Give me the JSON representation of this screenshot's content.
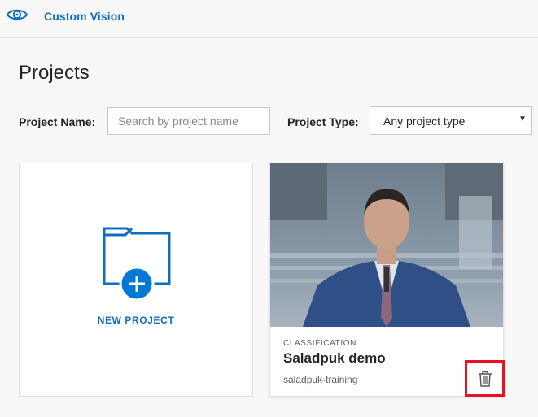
{
  "header": {
    "logo_icon": "eye-icon",
    "title": "Custom Vision"
  },
  "page": {
    "title": "Projects"
  },
  "filters": {
    "name_label": "Project Name:",
    "name_placeholder": "Search by project name",
    "name_value": "",
    "type_label": "Project Type:",
    "type_value": "Any project type"
  },
  "new_project": {
    "label": "NEW PROJECT",
    "icon": "folder-plus-icon"
  },
  "projects": [
    {
      "type": "CLASSIFICATION",
      "name": "Saladpuk demo",
      "resource": "saladpuk-training",
      "delete_icon": "trash-icon"
    }
  ],
  "colors": {
    "accent": "#106ebe",
    "primary_blue": "#0078d4",
    "highlight": "#e81123",
    "background": "#f8f8f8"
  }
}
